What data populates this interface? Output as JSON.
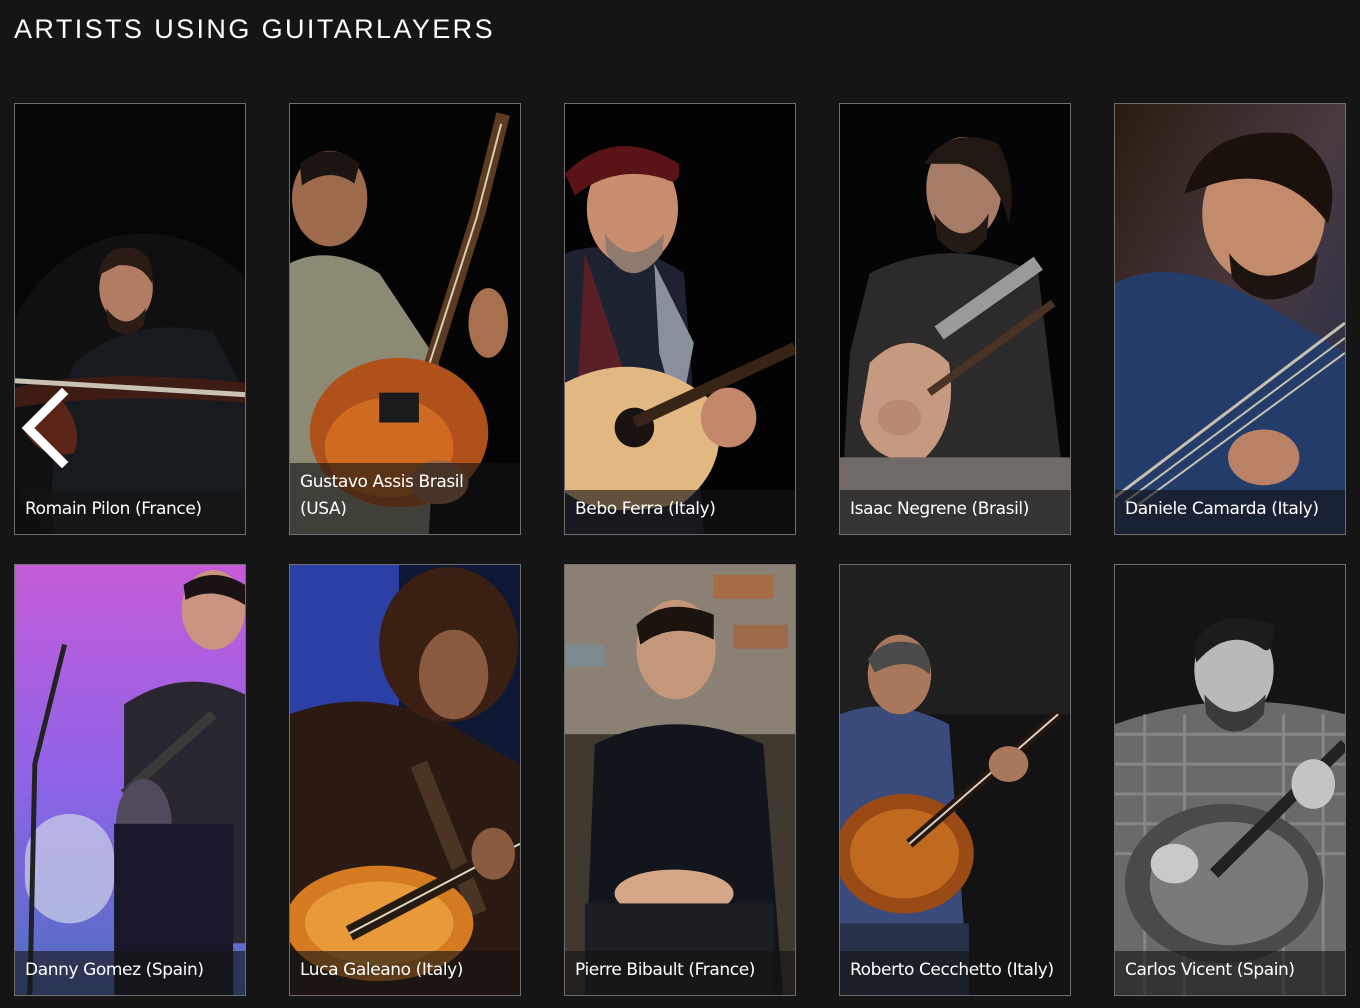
{
  "header": {
    "title": "ARTISTS USING GUITARLAYERS"
  },
  "carousel": {
    "prev_icon": "chevron-left-icon"
  },
  "artists": [
    {
      "name": "Romain Pilon (France)"
    },
    {
      "name": "Gustavo Assis Brasil (USA)"
    },
    {
      "name": "Bebo Ferra (Italy)"
    },
    {
      "name": "Isaac Negrene (Brasil)"
    },
    {
      "name": "Daniele Camarda (Italy)"
    },
    {
      "name": "Danny Gomez (Spain)"
    },
    {
      "name": "Luca Galeano (Italy)"
    },
    {
      "name": "Pierre Bibault (France)"
    },
    {
      "name": "Roberto Cecchetto (Italy)"
    },
    {
      "name": "Carlos Vicent (Spain)"
    }
  ]
}
